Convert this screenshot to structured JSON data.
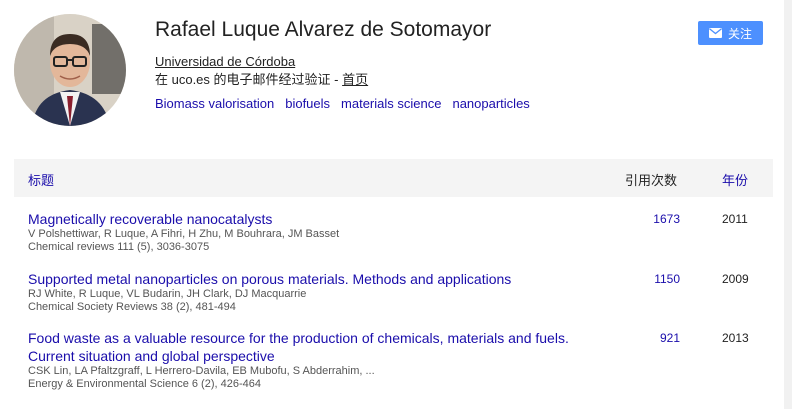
{
  "profile": {
    "name": "Rafael Luque Alvarez de Sotomayor",
    "affiliation": "Universidad de Córdoba",
    "verified_text": "在 uco.es 的电子邮件经过验证 - ",
    "homepage_label": "首页",
    "interests": [
      "Biomass valorisation",
      "biofuels",
      "materials science",
      "nanoparticles"
    ],
    "follow_label": "关注"
  },
  "table": {
    "headers": {
      "title": "标题",
      "cited_by": "引用次数",
      "year": "年份"
    },
    "rows": [
      {
        "title": "Magnetically recoverable nanocatalysts",
        "authors": "V Polshettiwar, R Luque, A Fihri, H Zhu, M Bouhrara, JM Basset",
        "venue": "Chemical reviews 111 (5), 3036-3075",
        "cited": "1673",
        "year": "2011"
      },
      {
        "title": "Supported metal nanoparticles on porous materials. Methods and applications",
        "authors": "RJ White, R Luque, VL Budarin, JH Clark, DJ Macquarrie",
        "venue": "Chemical Society Reviews 38 (2), 481-494",
        "cited": "1150",
        "year": "2009"
      },
      {
        "title": "Food waste as a valuable resource for the production of chemicals, materials and fuels. Current situation and global perspective",
        "authors": "CSK Lin, LA Pfaltzgraff, L Herrero-Davila, EB Mubofu, S Abderrahim, ...",
        "venue": "Energy & Environmental Science 6 (2), 426-464",
        "cited": "921",
        "year": "2013"
      }
    ]
  },
  "colors": {
    "link": "#1a0dab",
    "button": "#4d90fe",
    "header_bg": "#f4f4f4"
  }
}
